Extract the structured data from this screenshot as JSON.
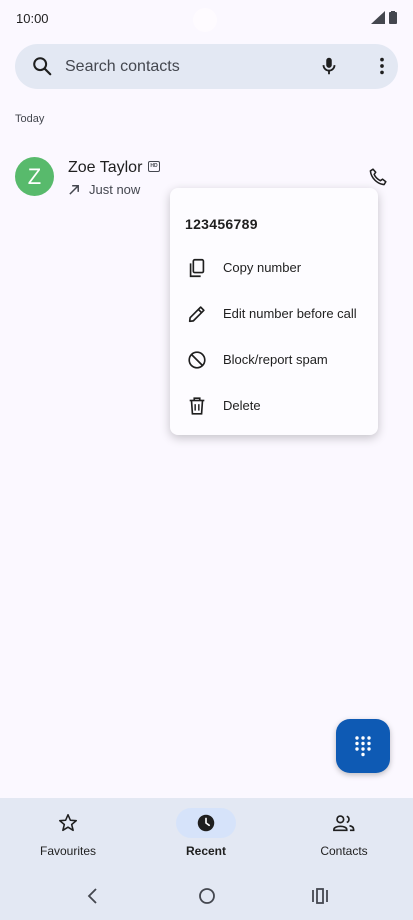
{
  "status_bar": {
    "time": "10:00"
  },
  "search": {
    "placeholder": "Search contacts"
  },
  "section_header": "Today",
  "call_log": [
    {
      "avatar_letter": "Z",
      "name": "Zoe Taylor",
      "hd_badge": "HD",
      "direction_icon": "outgoing-arrow-icon",
      "time": "Just now"
    }
  ],
  "context_menu": {
    "number": "123456789",
    "items": [
      {
        "icon": "copy-icon",
        "label": "Copy number"
      },
      {
        "icon": "edit-icon",
        "label": "Edit number before call"
      },
      {
        "icon": "block-icon",
        "label": "Block/report spam"
      },
      {
        "icon": "delete-icon",
        "label": "Delete"
      }
    ]
  },
  "bottom_nav": {
    "tabs": [
      {
        "icon": "star-icon",
        "label": "Favourites",
        "active": false
      },
      {
        "icon": "clock-icon",
        "label": "Recent",
        "active": true
      },
      {
        "icon": "contacts-icon",
        "label": "Contacts",
        "active": false
      }
    ]
  },
  "colors": {
    "accent": "#0e5ab4",
    "avatar": "#58ba6c",
    "surface": "#e3e8f3"
  }
}
